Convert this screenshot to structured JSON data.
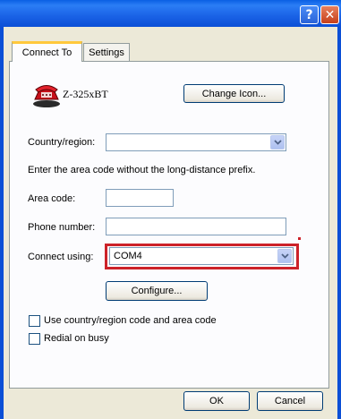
{
  "window": {
    "help_symbol": "?",
    "close_symbol": "✕"
  },
  "tabs": [
    {
      "label": "Connect To",
      "active": true
    },
    {
      "label": "Settings",
      "active": false
    }
  ],
  "connection": {
    "name": "Z-325xBT",
    "icon": "phone-icon"
  },
  "buttons": {
    "change_icon": "Change Icon...",
    "configure": "Configure...",
    "ok": "OK",
    "cancel": "Cancel"
  },
  "fields": {
    "country_label": "Country/region:",
    "country_value": "",
    "hint": "Enter the area code without the long-distance prefix.",
    "area_code_label": "Area code:",
    "area_code_value": "",
    "phone_label": "Phone number:",
    "phone_value": "",
    "connect_using_label": "Connect using:",
    "connect_using_value": "COM4"
  },
  "checkboxes": [
    {
      "label": "Use country/region code and area code",
      "checked": false
    },
    {
      "label": "Redial on busy",
      "checked": false
    }
  ],
  "colors": {
    "titlebar": "#0b4fd6",
    "highlight": "#cc2229",
    "tab_accent": "#ffc83c"
  }
}
